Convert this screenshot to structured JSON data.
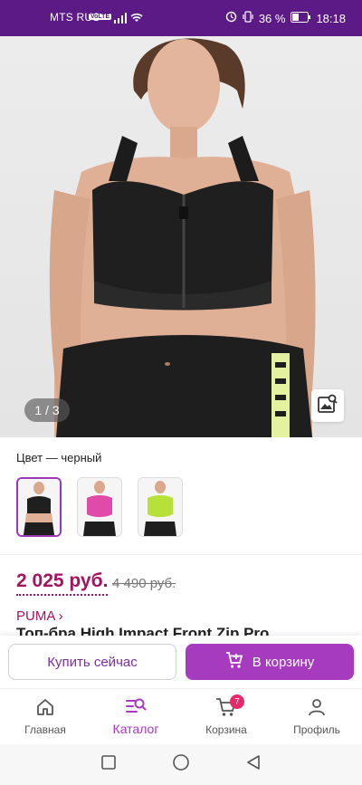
{
  "status": {
    "carrier": "MTS RUS",
    "volte": "VoLTE",
    "battery": "36 %",
    "time": "18:18"
  },
  "gallery": {
    "counter": "1 / 3"
  },
  "color": {
    "label": "Цвет — черный",
    "swatches": [
      "black",
      "pink",
      "lime"
    ]
  },
  "pricing": {
    "price": "2 025 руб.",
    "old_price": "4 490 руб."
  },
  "product": {
    "brand": "PUMA ›",
    "name": "Топ-бра High Impact Front Zip Pro"
  },
  "actions": {
    "buy_now": "Купить сейчас",
    "add_to_cart": "В корзину"
  },
  "tabs": {
    "home": "Главная",
    "catalog": "Каталог",
    "cart": "Корзина",
    "cart_badge": "7",
    "profile": "Профиль"
  },
  "colors": {
    "status_bar": "#5b1a86",
    "accent": "#a63bc0",
    "price": "#a3135f"
  }
}
